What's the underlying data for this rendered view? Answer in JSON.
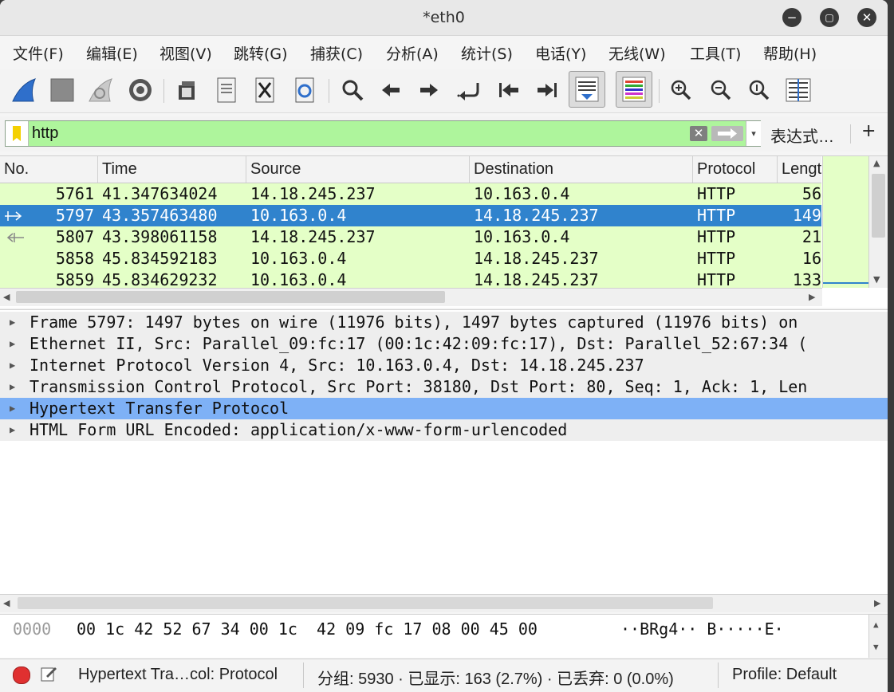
{
  "window": {
    "title": "*eth0"
  },
  "menu": [
    "文件(F)",
    "编辑(E)",
    "视图(V)",
    "跳转(G)",
    "捕获(C)",
    "分析(A)",
    "统计(S)",
    "电话(Y)",
    "无线(W)",
    "工具(T)",
    "帮助(H)"
  ],
  "filter": {
    "value": "http",
    "expression_label": "表达式…",
    "add_label": "+"
  },
  "packet_list": {
    "columns": [
      "No.",
      "Time",
      "Source",
      "Destination",
      "Protocol",
      "Lengt"
    ],
    "rows": [
      {
        "no": "5761",
        "time": "41.347634024",
        "source": "14.18.245.237",
        "destination": "10.163.0.4",
        "protocol": "HTTP",
        "length": "56"
      },
      {
        "no": "5797",
        "time": "43.357463480",
        "source": "10.163.0.4",
        "destination": "14.18.245.237",
        "protocol": "HTTP",
        "length": "149"
      },
      {
        "no": "5807",
        "time": "43.398061158",
        "source": "14.18.245.237",
        "destination": "10.163.0.4",
        "protocol": "HTTP",
        "length": "21"
      },
      {
        "no": "5858",
        "time": "45.834592183",
        "source": "10.163.0.4",
        "destination": "14.18.245.237",
        "protocol": "HTTP",
        "length": "16"
      },
      {
        "no": "5859",
        "time": "45.834629232",
        "source": "10.163.0.4",
        "destination": "14.18.245.237",
        "protocol": "HTTP",
        "length": "133"
      }
    ]
  },
  "details": [
    "Frame 5797: 1497 bytes on wire (11976 bits), 1497 bytes captured (11976 bits) on",
    "Ethernet II, Src: Parallel_09:fc:17 (00:1c:42:09:fc:17), Dst: Parallel_52:67:34 (",
    "Internet Protocol Version 4, Src: 10.163.0.4, Dst: 14.18.245.237",
    "Transmission Control Protocol, Src Port: 38180, Dst Port: 80, Seq: 1, Ack: 1, Len",
    "Hypertext Transfer Protocol",
    "HTML Form URL Encoded: application/x-www-form-urlencoded"
  ],
  "bytes": {
    "offset": "0000",
    "hex": "00 1c 42 52 67 34 00 1c  42 09 fc 17 08 00 45 00",
    "ascii": "··BRg4·· B·····E·"
  },
  "status": {
    "field": "Hypertext Tra…col: Protocol",
    "packets": "分组: 5930 · 已显示: 163 (2.7%) · 已丢弃: 0 (0.0%)",
    "profile": "Profile: Default"
  },
  "colors": {
    "row_bg": "#e4ffc7",
    "selected_row": "#3083cd",
    "selected_detail": "#7eb1f6",
    "filter_bg": "#aef59c"
  }
}
